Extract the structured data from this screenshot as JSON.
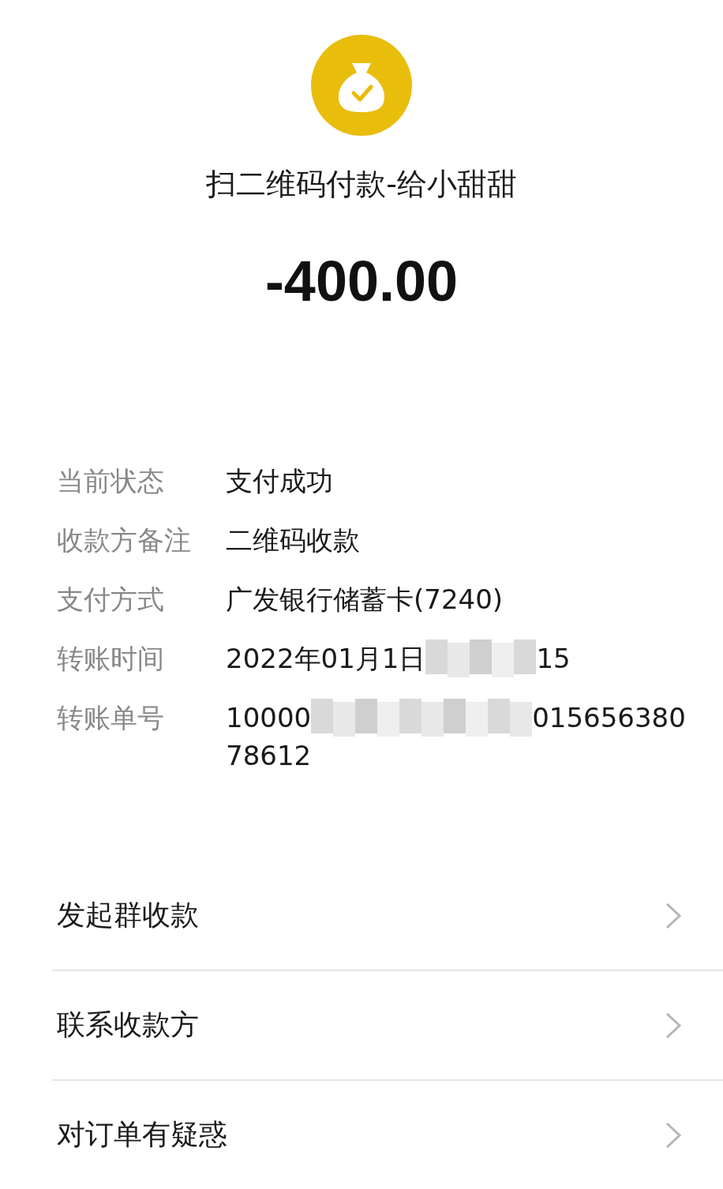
{
  "header": {
    "title": "扫二维码付款-给小甜甜",
    "amount": "-400.00"
  },
  "details": [
    {
      "label": "当前状态",
      "lines": [
        [
          {
            "kind": "text",
            "text": "支付成功"
          }
        ]
      ]
    },
    {
      "label": "收款方备注",
      "lines": [
        [
          {
            "kind": "text",
            "text": "二维码收款"
          }
        ]
      ]
    },
    {
      "label": "支付方式",
      "lines": [
        [
          {
            "kind": "text",
            "text": "广发银行储蓄卡(7240)"
          }
        ]
      ]
    },
    {
      "label": "转账时间",
      "lines": [
        [
          {
            "kind": "text",
            "text": "2022年01月1日"
          },
          {
            "kind": "redacted"
          },
          {
            "kind": "text",
            "text": "15"
          }
        ]
      ]
    },
    {
      "label": "转账单号",
      "lines": [
        [
          {
            "kind": "text",
            "text": "10000"
          },
          {
            "kind": "redacted"
          },
          {
            "kind": "text",
            "text": "015656380"
          }
        ],
        [
          {
            "kind": "text",
            "text": "78612"
          }
        ]
      ]
    }
  ],
  "menu": [
    {
      "label": "发起群收款"
    },
    {
      "label": "联系收款方"
    },
    {
      "label": "对订单有疑惑"
    }
  ]
}
